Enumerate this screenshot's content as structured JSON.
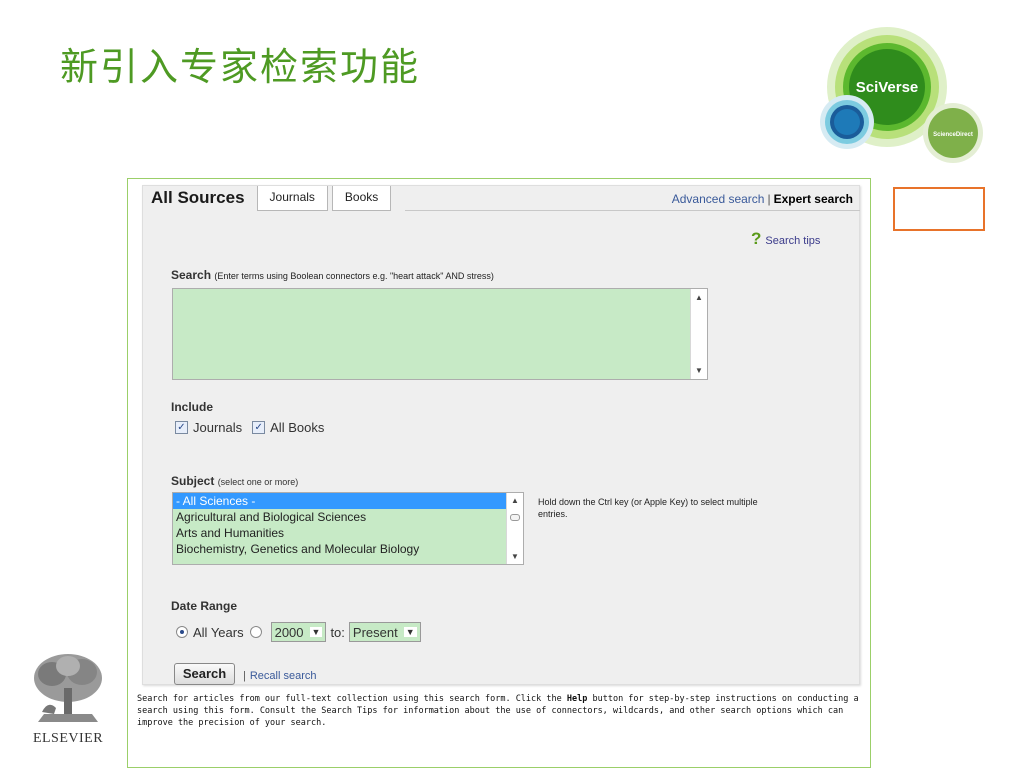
{
  "slide": {
    "title": "新引入专家检索功能"
  },
  "logo": {
    "main": "SciVerse",
    "sub": "ScienceDirect"
  },
  "publisher": {
    "name": "ELSEVIER"
  },
  "tabs": [
    {
      "label": "All Sources",
      "active": true
    },
    {
      "label": "Journals",
      "active": false
    },
    {
      "label": "Books",
      "active": false
    }
  ],
  "mode": {
    "advanced": "Advanced search",
    "separator": "|",
    "expert": "Expert search"
  },
  "tips": {
    "icon": "?",
    "label": "Search tips"
  },
  "search": {
    "label": "Search",
    "hint": "(Enter terms using Boolean connectors e.g. \"heart attack\" AND stress)",
    "value": ""
  },
  "include": {
    "label": "Include",
    "options": [
      {
        "label": "Journals",
        "checked": true
      },
      {
        "label": "All Books",
        "checked": true
      }
    ]
  },
  "subject": {
    "label": "Subject",
    "hint": "(select one or more)",
    "options": [
      "- All Sciences -",
      "Agricultural and Biological Sciences",
      "Arts and Humanities",
      "Biochemistry, Genetics and Molecular Biology"
    ],
    "selected_index": 0,
    "help": "Hold down the Ctrl key (or Apple Key) to select multiple entries."
  },
  "date_range": {
    "label": "Date Range",
    "all_years": "All Years",
    "from": "2000",
    "to_label": "to:",
    "to": "Present"
  },
  "actions": {
    "search_button": "Search",
    "separator": "|",
    "recall": "Recall search"
  },
  "footer": {
    "part1": "Search for articles from our full-text collection using this search form. Click the ",
    "help_word": "Help",
    "part2": " button for step-by-step instructions on conducting a search using this form. Consult the Search Tips for information about the use of connectors, wildcards, and other search options which can improve the precision of your search."
  },
  "colors": {
    "title_green": "#4e9a23",
    "field_green": "#c7eac6",
    "highlight_orange": "#e8732a",
    "selection_blue": "#3399ff"
  }
}
